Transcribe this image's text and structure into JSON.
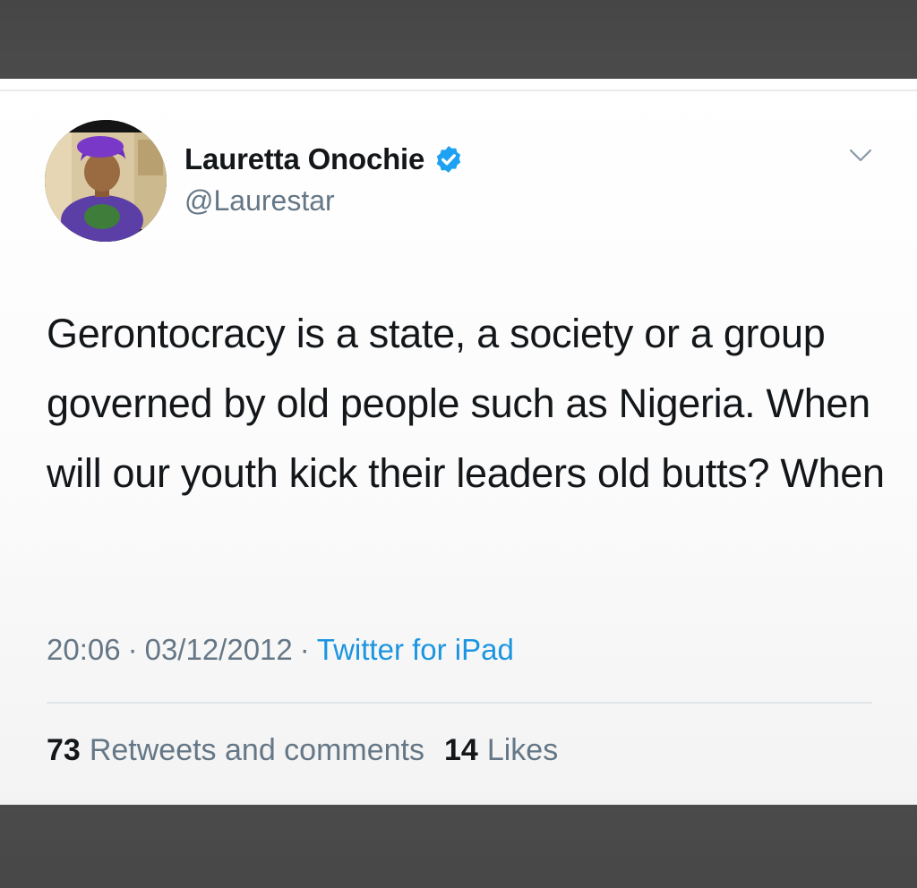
{
  "tweet": {
    "author": {
      "display_name": "Lauretta Onochie",
      "handle": "@Laurestar",
      "verified": true
    },
    "text": "Gerontocracy is a state, a society or a group governed by old people such as Nigeria. When will our youth kick their leaders old butts? When",
    "meta": {
      "time": "20:06",
      "date": "03/12/2012",
      "source": "Twitter for iPad",
      "separator": "·"
    },
    "stats": {
      "retweets_count": "73",
      "retweets_label": "Retweets and comments",
      "likes_count": "14",
      "likes_label": "Likes"
    }
  },
  "icons": {
    "verified": "verified-badge-icon",
    "menu": "chevron-down-icon"
  },
  "colors": {
    "verified_blue": "#1da1f2",
    "link_blue": "#1b95e0",
    "secondary_text": "#657786",
    "primary_text": "#14171a"
  }
}
